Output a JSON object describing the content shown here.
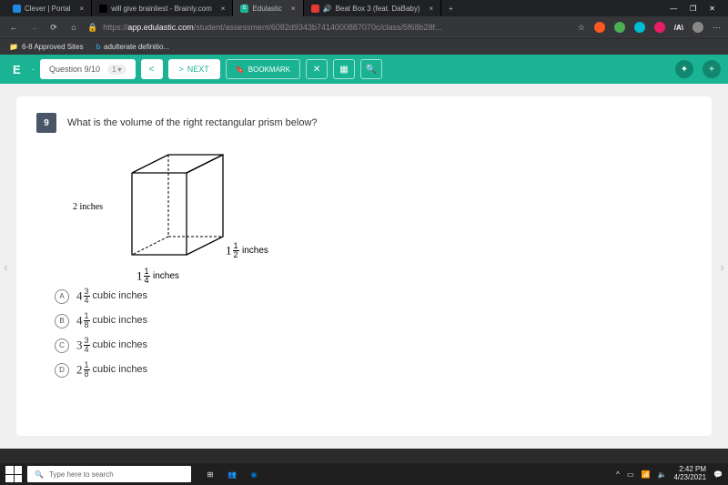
{
  "tabs": [
    {
      "label": "Clever | Portal",
      "favicon": "#1e88e5"
    },
    {
      "label": "will give brainliest - Brainly.com",
      "favicon": "#000"
    },
    {
      "label": "Edulastic",
      "favicon": "#1ab394",
      "active": true
    },
    {
      "label": "Beat Box 3 (feat. DaBaby)",
      "favicon": "#e53935"
    }
  ],
  "url": {
    "scheme": "https://",
    "host": "app.edulastic.com",
    "path": "/student/assessment/6082d9343b7414000887070c/class/5f68b28f..."
  },
  "bookmarks": [
    {
      "label": "6-8 Approved Sites",
      "color": "#fbc02d"
    },
    {
      "label": "adulterate definitio...",
      "color": "#29b6f6"
    }
  ],
  "header": {
    "logo": "E",
    "question_label": "Question 9/10",
    "chip": "1",
    "prev": "<",
    "next": "NEXT",
    "bookmark": "BOOKMARK",
    "close": "✕",
    "calc": "📅",
    "search": "🔍"
  },
  "question": {
    "number": "9",
    "text": "What is the volume of the right rectangular prism below?",
    "dims": {
      "height": "2 inches",
      "width_whole": "1",
      "width_num": "1",
      "width_den": "4",
      "width_unit": "inches",
      "depth_whole": "1",
      "depth_num": "1",
      "depth_den": "2",
      "depth_unit": "inches"
    },
    "choices": [
      {
        "letter": "A",
        "whole": "4",
        "num": "3",
        "den": "4",
        "unit": "cubic inches"
      },
      {
        "letter": "B",
        "whole": "4",
        "num": "1",
        "den": "8",
        "unit": "cubic inches"
      },
      {
        "letter": "C",
        "whole": "3",
        "num": "3",
        "den": "4",
        "unit": "cubic inches"
      },
      {
        "letter": "D",
        "whole": "2",
        "num": "1",
        "den": "8",
        "unit": "cubic inches"
      }
    ]
  },
  "taskbar": {
    "search_placeholder": "Type here to search",
    "time": "2:42 PM",
    "date": "4/23/2021"
  }
}
